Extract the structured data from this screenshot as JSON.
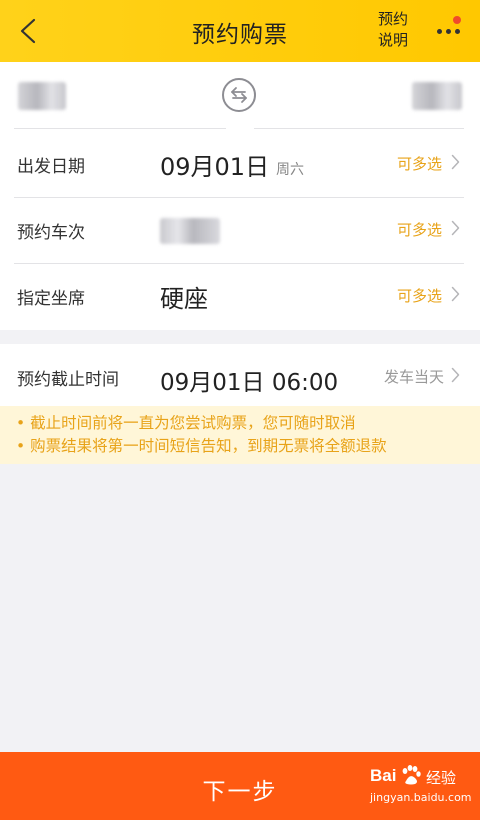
{
  "header": {
    "title": "预约购票",
    "info_link": "预约\n说明",
    "info_line1": "预约",
    "info_line2": "说明"
  },
  "rows": [
    {
      "label": "出发日期",
      "value": "09月01日",
      "sub": "周六",
      "action": "可多选"
    },
    {
      "label": "预约车次",
      "value": "",
      "action": "可多选"
    },
    {
      "label": "指定坐席",
      "value": "硬座",
      "action": "可多选"
    }
  ],
  "deadline": {
    "label": "预约截止时间",
    "value": "09月01日 06:00",
    "action": "发车当天"
  },
  "notice": [
    "• 截止时间前将一直为您尝试购票，您可随时取消",
    "• 购票结果将第一时间短信告知，到期无票将全额退款"
  ],
  "footer": {
    "next_label": "下一步"
  },
  "watermark": {
    "brand": "Bai",
    "suffix": "经验",
    "url": "jingyan.baidu.com"
  },
  "colors": {
    "header_bg": "#ffd21a",
    "accent": "#e8a319",
    "button_bg": "#ff5a12"
  }
}
